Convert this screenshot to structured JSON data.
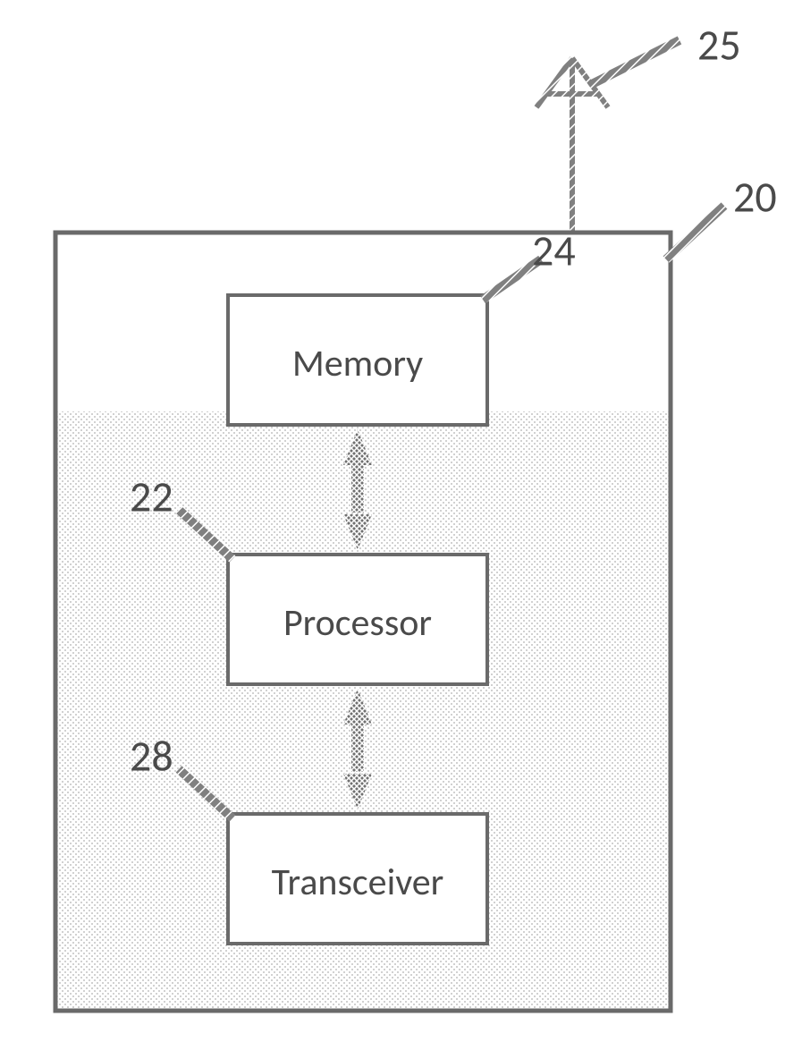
{
  "diagram": {
    "device_ref": "20",
    "antenna_ref": "25",
    "blocks": {
      "memory": {
        "label": "Memory",
        "ref": "24"
      },
      "processor": {
        "label": "Processor",
        "ref": "22"
      },
      "transceiver": {
        "label": "Transceiver",
        "ref": "28"
      }
    }
  }
}
